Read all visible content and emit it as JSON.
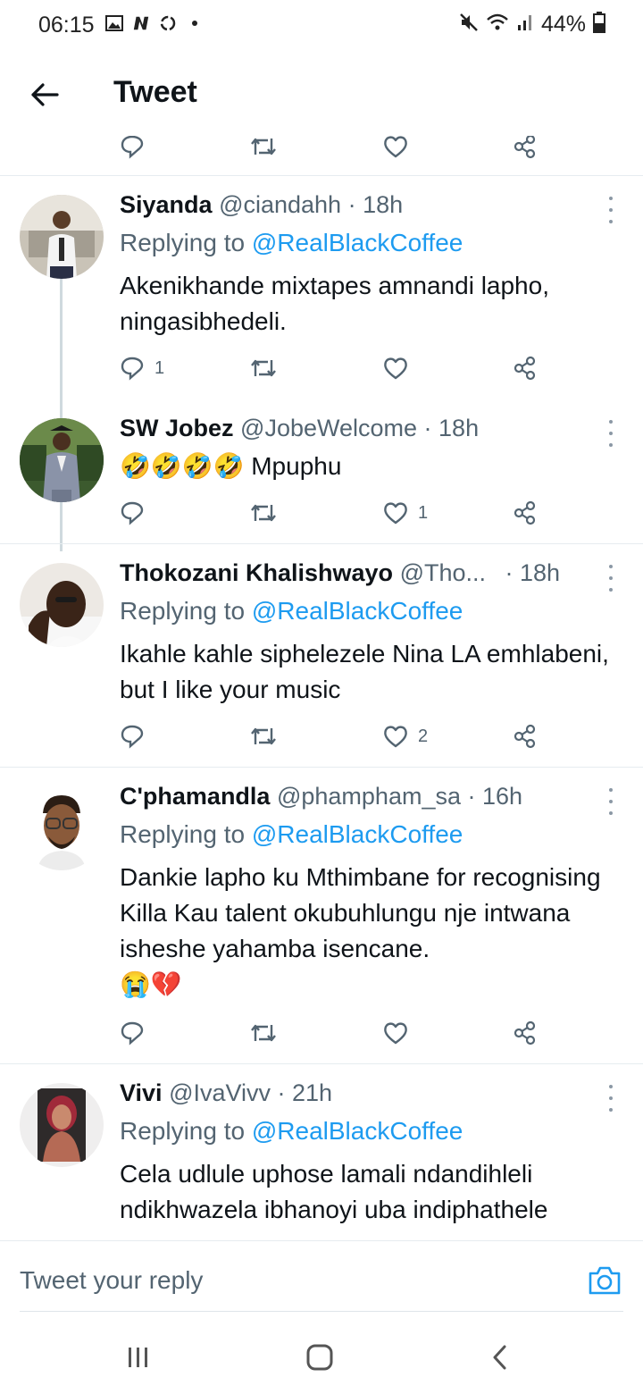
{
  "status_bar": {
    "time": "06:15",
    "battery": "44%",
    "icons": [
      "image-icon",
      "n-icon",
      "recycle-icon",
      "dot-icon",
      "mute-icon",
      "wifi-icon",
      "signal-icon",
      "battery-icon"
    ]
  },
  "header": {
    "title": "Tweet"
  },
  "tweets": [
    {
      "name": "Siyanda",
      "handle": "@ciandahh",
      "time": "· 18h",
      "replying_label": "Replying to",
      "replying_to": "@RealBlackCoffee",
      "text": "Akenikhande mixtapes amnandi lapho, ningasibhedeli.",
      "replies": "1",
      "retweets": "",
      "likes": ""
    },
    {
      "name": "SW Jobez",
      "handle": "@JobeWelcome",
      "time": "· 18h",
      "emoji": "🤣🤣🤣🤣",
      "text": "Mpuphu",
      "replies": "",
      "retweets": "",
      "likes": "1"
    },
    {
      "name": "Thokozani Khalishwayo",
      "handle": "@Tho...",
      "time": "· 18h",
      "replying_label": "Replying to",
      "replying_to": "@RealBlackCoffee",
      "text": "Ikahle kahle siphelezele Nina LA emhlabeni, but I like your music",
      "replies": "",
      "retweets": "",
      "likes": "2"
    },
    {
      "name": "C'phamandla",
      "handle": "@phampham_sa",
      "time": "· 16h",
      "replying_label": "Replying to",
      "replying_to": "@RealBlackCoffee",
      "text": "Dankie lapho ku Mthimbane for recognising Killa Kau talent okubuhlungu nje intwana isheshe yahamba isencane.",
      "emoji": "😭💔",
      "replies": "",
      "retweets": "",
      "likes": ""
    },
    {
      "name": "Vivi",
      "handle": "@IvaVivv",
      "time": "· 21h",
      "replying_label": "Replying to",
      "replying_to": "@RealBlackCoffee",
      "text": "Cela udlule uphose lamali ndandihleli ndikhwazela ibhanoyi uba indiphathele",
      "replies": "",
      "retweets": "",
      "likes": ""
    }
  ],
  "reply_bar": {
    "placeholder": "Tweet your reply"
  },
  "colors": {
    "accent": "#1d9bf0",
    "muted": "#536471",
    "text": "#0f1419",
    "divider": "#e6ecf0"
  }
}
